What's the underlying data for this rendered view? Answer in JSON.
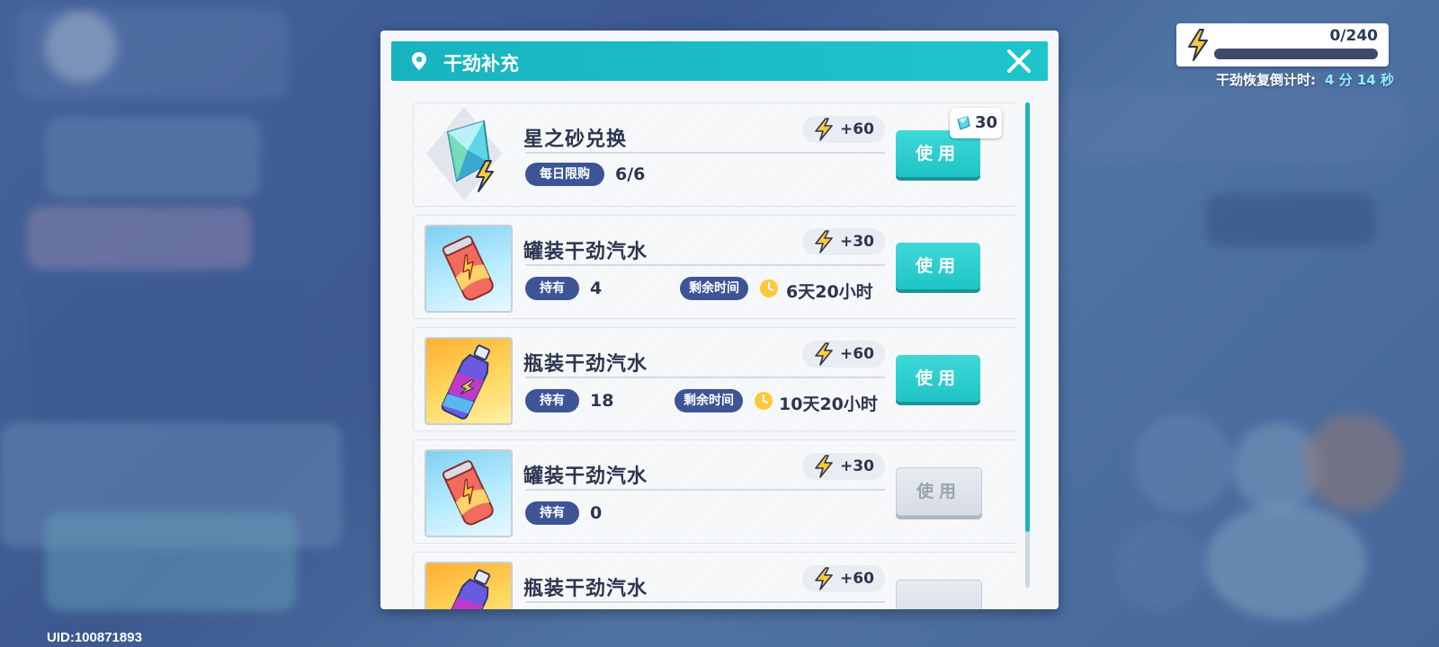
{
  "uid": "UID:100871893",
  "energy": {
    "display": "0/240",
    "fill": 0,
    "timer_label": "干劲恢复倒计时:",
    "timer_value": "4 分 14 秒"
  },
  "dialog": {
    "title": "干劲补充",
    "items": [
      {
        "name": "星之砂兑换",
        "gain": "+60",
        "tag_label": "每日限购",
        "tag_value": "6/6",
        "cost": "30",
        "button": "使用",
        "enabled": true,
        "icon": "star-sand-crystal-icon"
      },
      {
        "name": "罐装干劲汽水",
        "gain": "+30",
        "tag_label": "持有",
        "tag_value": "4",
        "time_label": "剩余时间",
        "time_value": "6天20小时",
        "button": "使用",
        "enabled": true,
        "icon": "energy-can-icon"
      },
      {
        "name": "瓶装干劲汽水",
        "gain": "+60",
        "tag_label": "持有",
        "tag_value": "18",
        "time_label": "剩余时间",
        "time_value": "10天20小时",
        "button": "使用",
        "enabled": true,
        "icon": "energy-bottle-icon"
      },
      {
        "name": "罐装干劲汽水",
        "gain": "+30",
        "tag_label": "持有",
        "tag_value": "0",
        "button": "使用",
        "enabled": false,
        "icon": "energy-can-icon"
      },
      {
        "name": "瓶装干劲汽水",
        "gain": "+60",
        "icon": "energy-bottle-icon"
      }
    ]
  },
  "colors": {
    "accent": "#1fc4c6",
    "pill": "#3d5496",
    "bolt": "#ffc83c"
  }
}
